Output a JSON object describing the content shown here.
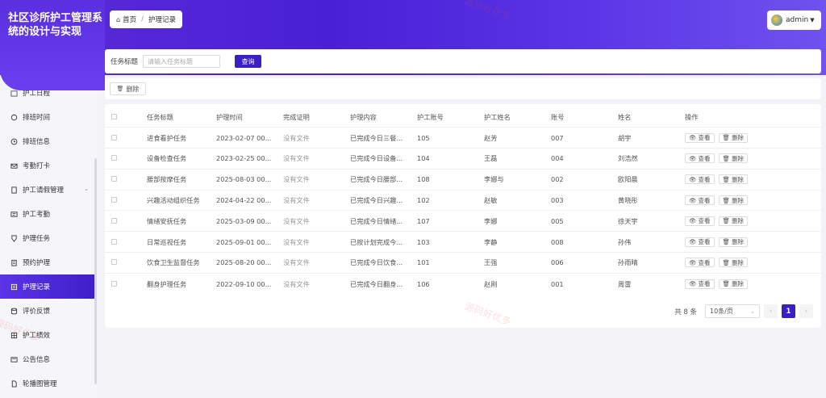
{
  "app": {
    "title": "社区诊所护工管理系统的设计与实现"
  },
  "breadcrumb": {
    "home": "首页",
    "separator": "/",
    "current": "护理记录"
  },
  "user": {
    "name": "admin",
    "dropdown_icon": "caret-down-icon"
  },
  "sidebar": {
    "partial_top": "护工日程",
    "items": [
      {
        "label": "排班时间",
        "icon": "chat-icon"
      },
      {
        "label": "排班信息",
        "icon": "clock-icon"
      },
      {
        "label": "考勤打卡",
        "icon": "mail-icon"
      },
      {
        "label": "护工请假管理",
        "icon": "book-icon"
      },
      {
        "label": "护工考勤",
        "icon": "card-icon"
      },
      {
        "label": "护理任务",
        "icon": "medal-icon"
      },
      {
        "label": "预约护理",
        "icon": "clipboard-icon"
      },
      {
        "label": "护理记录",
        "icon": "list-icon"
      },
      {
        "label": "评价反馈",
        "icon": "database-icon"
      },
      {
        "label": "护工绩效",
        "icon": "grid-icon"
      },
      {
        "label": "公告信息",
        "icon": "notice-icon"
      },
      {
        "label": "轮播图管理",
        "icon": "file-icon"
      }
    ],
    "active_index": 7
  },
  "search": {
    "label": "任务标题",
    "placeholder": "请输入任务标题",
    "button": "查询"
  },
  "toolbar": {
    "delete_label": "删除"
  },
  "table": {
    "columns": [
      "任务标题",
      "护理时间",
      "完成证明",
      "护理内容",
      "护工账号",
      "护工姓名",
      "账号",
      "姓名",
      "操作"
    ],
    "rows": [
      [
        "进食看护任务",
        "2023-02-07 00...",
        "没有文件",
        "已完成今日三餐...",
        "105",
        "赵芳",
        "007",
        "胡宇"
      ],
      [
        "设备检查任务",
        "2023-02-25 00...",
        "没有文件",
        "已完成今日设备...",
        "104",
        "王磊",
        "004",
        "刘浩然"
      ],
      [
        "腰部按摩任务",
        "2025-08-03 00...",
        "没有文件",
        "已完成今日腰部...",
        "108",
        "李娜与",
        "002",
        "欧阳晨"
      ],
      [
        "兴趣活动组织任务",
        "2024-04-22 00...",
        "没有文件",
        "已完成今日兴趣...",
        "102",
        "赵敏",
        "003",
        "黄晓彤"
      ],
      [
        "情绪安抚任务",
        "2025-03-09 00...",
        "没有文件",
        "已完成今日情绪...",
        "107",
        "李娜",
        "005",
        "徐天宇"
      ],
      [
        "日常巡视任务",
        "2025-09-01 00...",
        "没有文件",
        "已按计划完成今...",
        "103",
        "李静",
        "008",
        "孙伟"
      ],
      [
        "饮食卫生监督任务",
        "2025-08-20 00...",
        "没有文件",
        "已完成今日饮食...",
        "101",
        "王强",
        "006",
        "孙雨晴"
      ],
      [
        "翻身护理任务",
        "2022-09-10 00...",
        "没有文件",
        "已完成今日翻身...",
        "106",
        "赵刚",
        "001",
        "周雷"
      ]
    ],
    "view_label": "查看",
    "delete_label": "删除"
  },
  "pagination": {
    "total": "共 8 条",
    "page_size": "10条/页",
    "current_page": "1",
    "prev": "‹",
    "next": "›"
  },
  "watermark": "源码好优多",
  "colors": {
    "accent": "#3b1ec4",
    "header": "#5a34e6"
  }
}
